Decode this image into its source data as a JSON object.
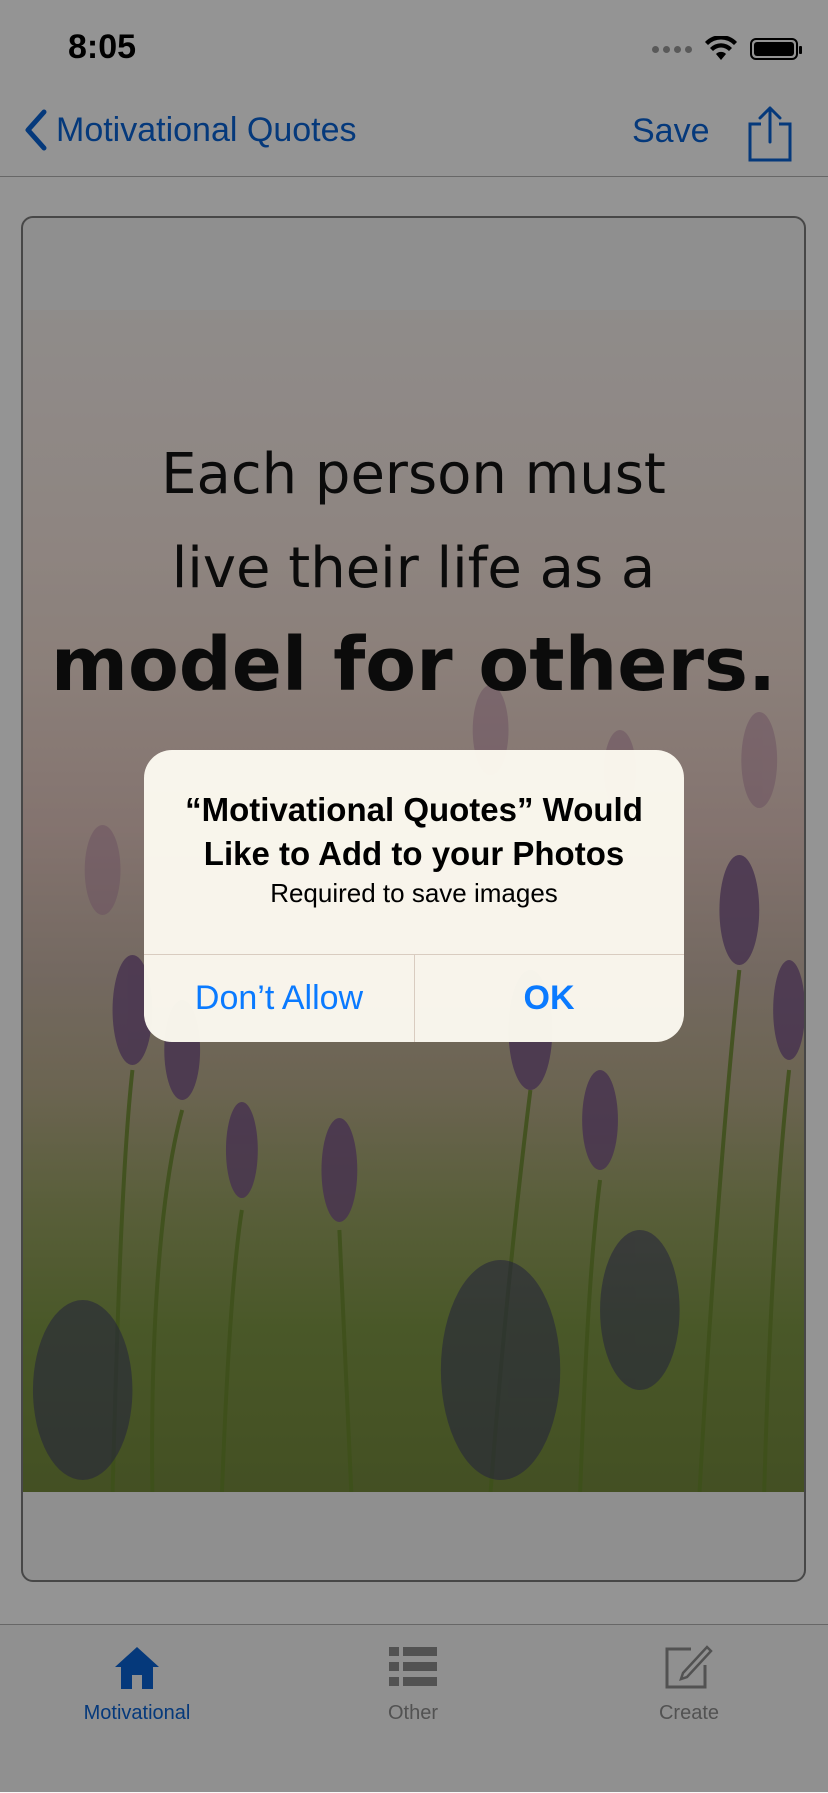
{
  "status_bar": {
    "time": "8:05"
  },
  "nav": {
    "back_label": "Motivational Quotes",
    "save_label": "Save"
  },
  "quote": {
    "line1": "Each person must",
    "line2": "live their life as a",
    "line3": "model for others."
  },
  "alert": {
    "title": "“Motivational Quotes” Would Like to Add to your Photos",
    "message": "Required to save images",
    "deny_label": "Don’t Allow",
    "ok_label": "OK"
  },
  "tabs": [
    {
      "label": "Motivational",
      "icon": "house-icon",
      "selected": true
    },
    {
      "label": "Other",
      "icon": "list-icon",
      "selected": false
    },
    {
      "label": "Create",
      "icon": "compose-icon",
      "selected": false
    }
  ],
  "colors": {
    "accent": "#0a62d4",
    "alert_button": "#0a7aff",
    "tab_inactive": "#8e8e8e"
  }
}
